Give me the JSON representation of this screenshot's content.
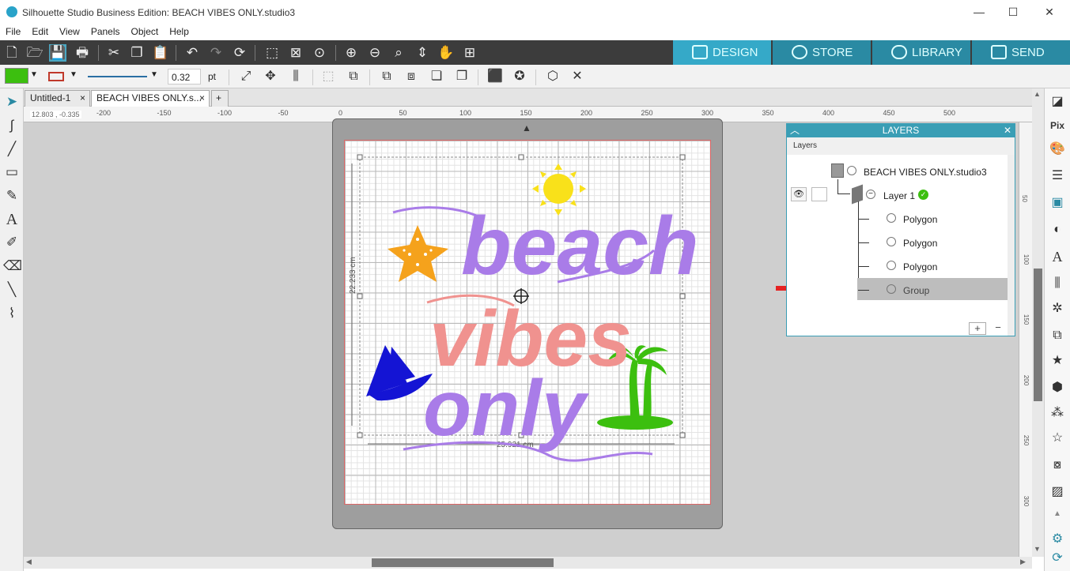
{
  "window": {
    "title": "Silhouette Studio Business Edition: BEACH VIBES ONLY.studio3",
    "minimize": "—",
    "maximize": "☐",
    "close": "✕"
  },
  "menu": [
    "File",
    "Edit",
    "View",
    "Panels",
    "Object",
    "Help"
  ],
  "nav_tabs": [
    {
      "label": "DESIGN",
      "active": true
    },
    {
      "label": "STORE",
      "active": false
    },
    {
      "label": "LIBRARY",
      "active": false
    },
    {
      "label": "SEND",
      "active": false
    }
  ],
  "line_toolbar": {
    "fill_color": "#3cbf0f",
    "line_color": "#c0392b",
    "line_width": "0.32",
    "line_unit": "pt"
  },
  "doc_tabs": [
    {
      "label": "Untitled-1",
      "close": "×",
      "active": false
    },
    {
      "label": "BEACH VIBES ONLY.s...",
      "close": "×",
      "active": true
    },
    {
      "label": "+"
    }
  ],
  "ruler": {
    "coords": "12.803 , -0.335",
    "top_ticks": [
      "-200",
      "-150",
      "-100",
      "-50",
      "0",
      "50",
      "100",
      "150",
      "200",
      "250",
      "300",
      "350",
      "400",
      "450",
      "500"
    ],
    "right_ticks": [
      "50",
      "100",
      "150",
      "200",
      "250",
      "300"
    ]
  },
  "canvas": {
    "height_dim": "22.233 cm",
    "width_dim": "25.921 cm",
    "design_words": [
      "beach",
      "vibes",
      "only"
    ]
  },
  "colors": {
    "accent": "#3a9eb5",
    "purple": "#a97ce8",
    "pink": "#f0928f",
    "orange": "#f5a21c",
    "yellow": "#f9e11a",
    "blue": "#1414d4",
    "green": "#3cbf0f",
    "arrow": "#e52222"
  },
  "layers_panel": {
    "title": "LAYERS",
    "subheader": "Layers",
    "document": "BEACH VIBES ONLY.studio3",
    "layer": "Layer 1",
    "items": [
      {
        "label": "Polygon",
        "selected": false
      },
      {
        "label": "Polygon",
        "selected": false
      },
      {
        "label": "Polygon",
        "selected": false
      },
      {
        "label": "Group",
        "selected": true
      }
    ],
    "add": "+",
    "remove": "−"
  }
}
